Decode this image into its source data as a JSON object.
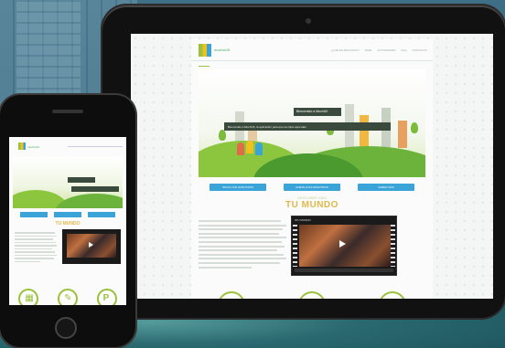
{
  "background": {
    "name": "city-photo-background"
  },
  "tablet": {
    "site": {
      "logo_text": "muchoUK",
      "nav": [
        "¿QUÉ ES MUCHOUK?",
        "FASE",
        "ACTIVIDADES",
        "FAQ",
        "CONTACTO"
      ],
      "hero": {
        "banner": "Bienvenido a MuchUK",
        "caption": "Bienvenido a MuchUK, la aplicación para que tus hijos aprendan"
      },
      "buttons": [
        "INICIA CON NOSOTROS",
        "UNETE CON NOSOTROS",
        "SABER MÁS"
      ],
      "section_subtitle": "DESCUBRE MÁS",
      "section_title": "TU MUNDO",
      "video": {
        "title": "#TU MUNDO",
        "label": "video-player"
      },
      "icons": [
        "building-icon",
        "wrench-icon",
        "parking-icon"
      ]
    }
  },
  "phone": {
    "site": {
      "logo_text": "muchoUK",
      "section_title": "TU MUNDO",
      "icons": [
        "building-icon",
        "wrench-icon",
        "parking-icon"
      ]
    }
  },
  "colors": {
    "accent_green": "#9ac23c",
    "accent_blue": "#3aa3d8",
    "accent_gold": "#e2b84a"
  }
}
